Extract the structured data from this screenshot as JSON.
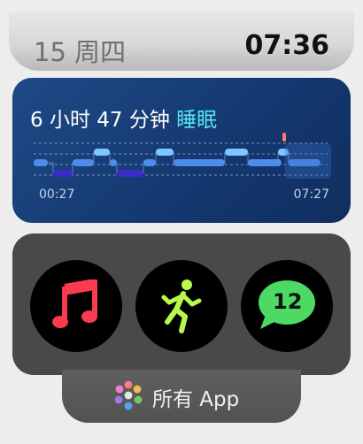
{
  "status": {
    "date": "15 周四",
    "time": "07:36"
  },
  "sleep": {
    "duration": "6 小时 47 分钟",
    "category": "睡眠",
    "start_time": "00:27",
    "end_time": "07:27",
    "colors": {
      "accent": "#54e6ee",
      "core": "#4d8ce8",
      "rem": "#7cc7ff",
      "deep": "#3a2cc4",
      "awake": "#ff7a6e"
    }
  },
  "apps": [
    {
      "name": "music",
      "icon": "music-note-icon",
      "color": "#fa3a4f"
    },
    {
      "name": "workout",
      "icon": "running-figure-icon",
      "color": "#b7f84b"
    },
    {
      "name": "messages",
      "icon": "message-bubble-icon",
      "color": "#4cd964",
      "badge": "12"
    }
  ],
  "all_apps": {
    "label": "所有 App",
    "icon": "app-grid-icon"
  }
}
